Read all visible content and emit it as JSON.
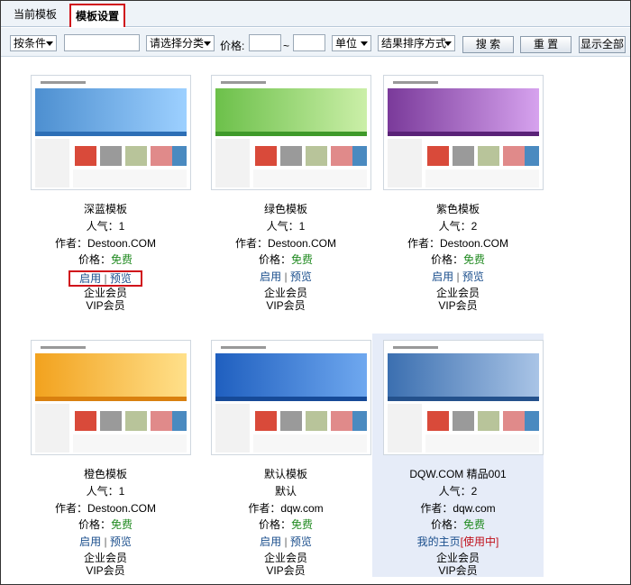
{
  "tabs": [
    {
      "label": "当前模板"
    },
    {
      "label": "模板设置"
    }
  ],
  "toolbar": {
    "condition": "按条件",
    "category": "请选择分类",
    "price_label": "价格:",
    "range_sep": "~",
    "unit": "单位",
    "sort": "结果排序方式",
    "search_btn": "搜 索",
    "reset_btn": "重 置",
    "show_all_btn": "显示全部"
  },
  "templates": [
    {
      "name": "深蓝模板",
      "popularity": "人气：1",
      "author": "作者：Destoon.COM",
      "price_label": "价格：",
      "price": "免费",
      "enable": "启用",
      "sep": "|",
      "preview": "预览",
      "member1": "企业会员",
      "member2": "VIP会员",
      "banner": "#4d8fd0",
      "banner2": "#9dd0ff",
      "nav": "#2d6fb6"
    },
    {
      "name": "绿色模板",
      "popularity": "人气：1",
      "author": "作者：Destoon.COM",
      "price_label": "价格：",
      "price": "免费",
      "enable": "启用",
      "sep": "|",
      "preview": "预览",
      "member1": "企业会员",
      "member2": "VIP会员",
      "banner": "#6cc04a",
      "banner2": "#cbefa8",
      "nav": "#3f9a2a"
    },
    {
      "name": "紫色模板",
      "popularity": "人气：2",
      "author": "作者：Destoon.COM",
      "price_label": "价格：",
      "price": "免费",
      "enable": "启用",
      "sep": "|",
      "preview": "预览",
      "member1": "企业会员",
      "member2": "VIP会员",
      "banner": "#7a3a9a",
      "banner2": "#d6a2ee",
      "nav": "#5a2278"
    },
    {
      "name": "橙色模板",
      "popularity": "人气：1",
      "author": "作者：Destoon.COM",
      "price_label": "价格：",
      "price": "免费",
      "enable": "启用",
      "sep": "|",
      "preview": "预览",
      "member1": "企业会员",
      "member2": "VIP会员",
      "banner": "#f2a21e",
      "banner2": "#ffe08a",
      "nav": "#d9800f"
    },
    {
      "name": "默认模板",
      "subtitle": "默认",
      "author": "作者：dqw.com",
      "price_label": "价格：",
      "price": "免费",
      "enable": "启用",
      "sep": "|",
      "preview": "预览",
      "member1": "企业会员",
      "member2": "VIP会员",
      "banner": "#1f5fbf",
      "banner2": "#6fa8ef",
      "nav": "#164a98"
    },
    {
      "name": "DQW.COM 精品001",
      "popularity": "人气：2",
      "author": "作者：dqw.com",
      "price_label": "价格：",
      "price": "免费",
      "homepage": "我的主页",
      "in_use": "[使用中]",
      "member1": "企业会员",
      "member2": "VIP会员",
      "banner": "#3b6fb0",
      "banner2": "#a9c4e6",
      "nav": "#24518c"
    }
  ]
}
